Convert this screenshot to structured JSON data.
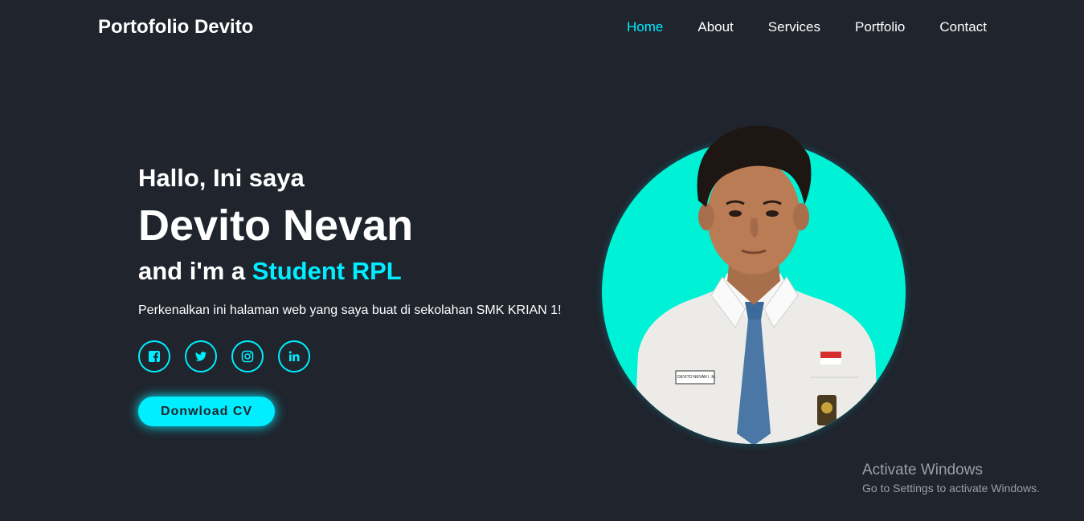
{
  "header": {
    "logo": "Portofolio Devito",
    "nav": [
      "Home",
      "About",
      "Services",
      "Portfolio",
      "Contact"
    ],
    "active_nav": "Home"
  },
  "home": {
    "greeting": "Hallo, Ini saya",
    "name": "Devito Nevan",
    "role_prefix": "and i'm a ",
    "role_highlight": "Student RPL",
    "description": "Perkenalkan ini halaman web yang saya buat di sekolahan SMK KRIAN 1!",
    "socials": [
      "facebook-icon",
      "twitter-icon",
      "instagram-icon",
      "linkedin-icon"
    ],
    "cta_label": "Donwload CV"
  },
  "photo": {
    "name_tag": "DEVITO NEVAN I. M."
  },
  "colors": {
    "background": "#1f242d",
    "accent": "#00eeff",
    "circle": "#00f2d6"
  },
  "watermark": {
    "title": "Activate Windows",
    "subtitle": "Go to Settings to activate Windows."
  }
}
